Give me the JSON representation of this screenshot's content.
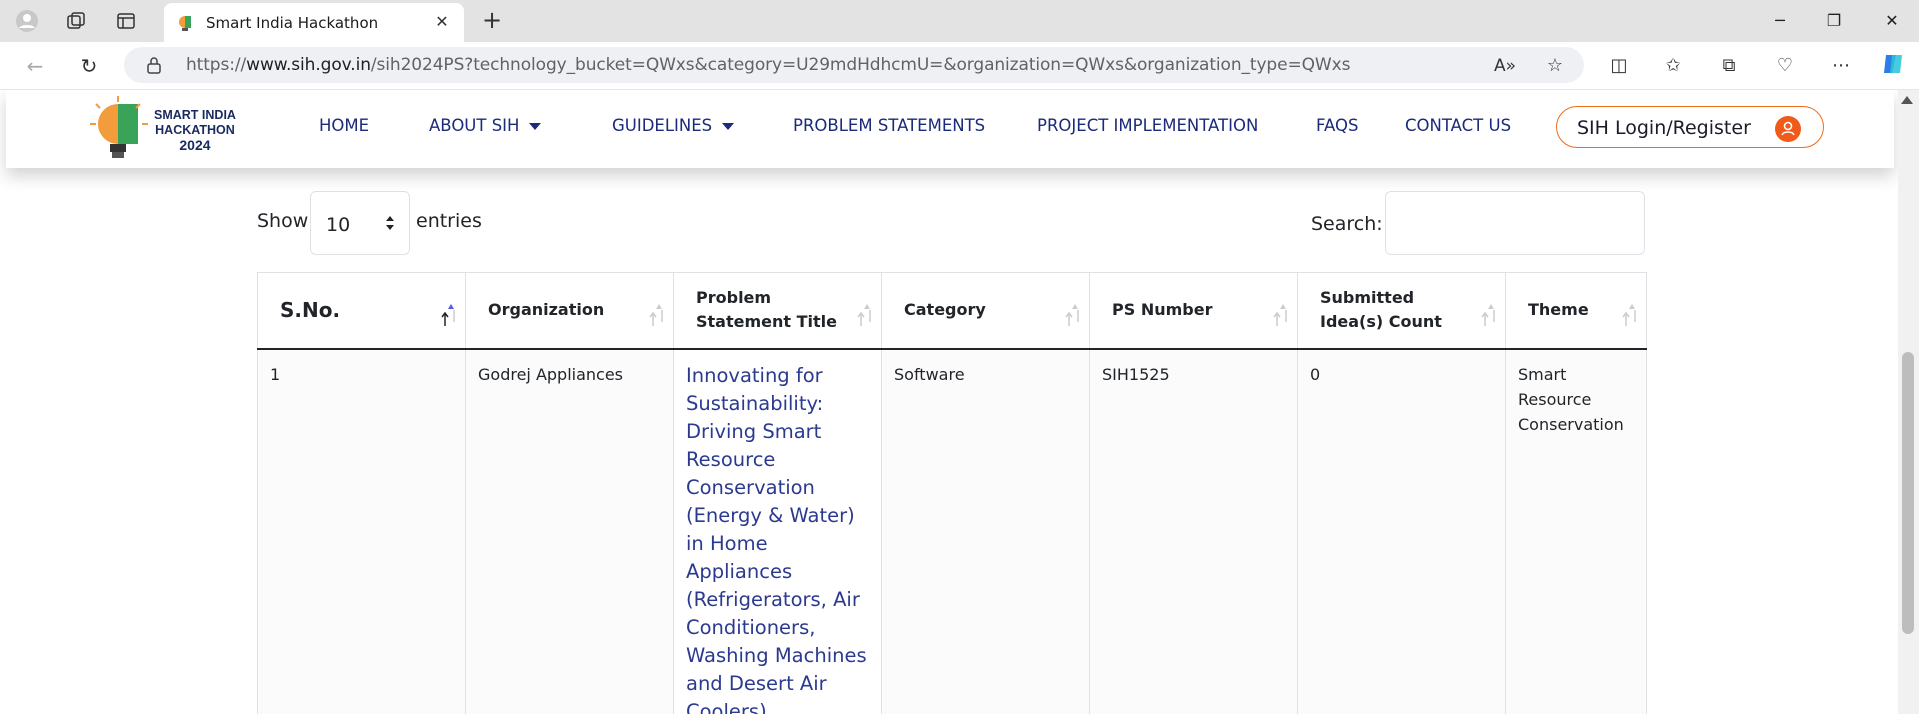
{
  "browser": {
    "tab_title": "Smart India Hackathon",
    "url_prefix": "https://",
    "url_domain": "www.sih.gov.in",
    "url_path": "/sih2024PS?technology_bucket=QWxs&category=U29mdHdhcmU=&organization=QWxs&organization_type=QWxs"
  },
  "site": {
    "logo_line1": "SMART INDIA",
    "logo_line2": "HACKATHON",
    "logo_line3": "2024",
    "nav": {
      "home": "HOME",
      "about": "ABOUT SIH",
      "guidelines": "GUIDELINES",
      "problem_statements": "PROBLEM STATEMENTS",
      "project_implementation": "PROJECT IMPLEMENTATION",
      "faqs": "FAQS",
      "contact": "CONTACT US"
    },
    "login_label": "SIH Login/Register",
    "accent_color": "#ef6c1a",
    "nav_color": "#1b2a7a"
  },
  "table_controls": {
    "show_label": "Show",
    "entries_value": "10",
    "entries_label": "entries",
    "search_label": "Search:",
    "search_value": ""
  },
  "table": {
    "columns": [
      "S.No.",
      "Organization",
      "Problem Statement Title",
      "Category",
      "PS Number",
      "Submitted Idea(s) Count",
      "Theme"
    ],
    "rows": [
      {
        "sno": "1",
        "organization": "Godrej Appliances",
        "title": "Innovating for Sustainability: Driving Smart Resource Conservation (Energy & Water) in Home Appliances (Refrigerators, Air Conditioners, Washing Machines and Desert Air Coolers)",
        "category": "Software",
        "ps_number": "SIH1525",
        "idea_count": "0",
        "theme": "Smart Resource Conservation"
      }
    ]
  }
}
